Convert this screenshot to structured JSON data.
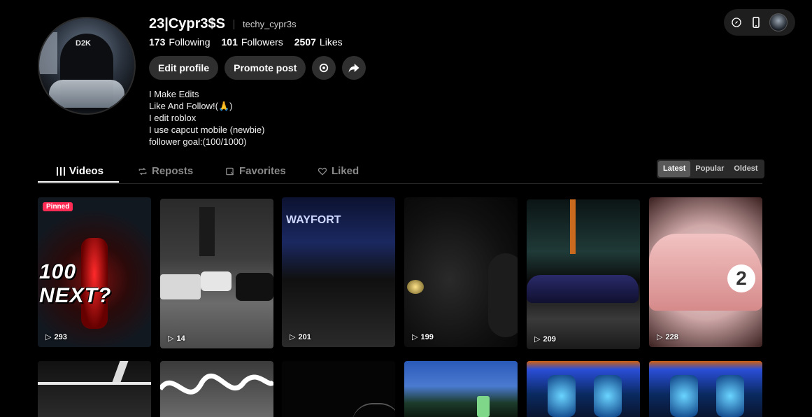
{
  "profile": {
    "username": "23|Cypr3$S",
    "handle": "techy_cypr3s",
    "avatar_text": "D2K",
    "stats": [
      {
        "value": "173",
        "label": "Following"
      },
      {
        "value": "101",
        "label": "Followers"
      },
      {
        "value": "2507",
        "label": "Likes"
      }
    ],
    "edit_profile_label": "Edit profile",
    "promote_post_label": "Promote post",
    "bio_lines": [
      "I Make Edits",
      "Like And Follow!(🙏)",
      "I edit roblox",
      "I use capcut mobile (newbie)",
      "follower goal:(100/1000)"
    ]
  },
  "tabs": [
    {
      "label": "Videos",
      "icon": "grid-icon",
      "active": true
    },
    {
      "label": "Reposts",
      "icon": "repost-icon",
      "active": false
    },
    {
      "label": "Favorites",
      "icon": "bookmark-icon",
      "active": false
    },
    {
      "label": "Liked",
      "icon": "heart-icon",
      "active": false
    }
  ],
  "sort": {
    "options": [
      "Latest",
      "Popular",
      "Oldest"
    ],
    "selected": "Latest"
  },
  "videos": [
    {
      "views": "293",
      "pinned_label": "Pinned",
      "overlay_text": "100 NEXT?"
    },
    {
      "views": "14"
    },
    {
      "views": "201",
      "overlay_text": "WAYFORT"
    },
    {
      "views": "199"
    },
    {
      "views": "209"
    },
    {
      "views": "228"
    }
  ],
  "accent_color": "#fe2c55"
}
